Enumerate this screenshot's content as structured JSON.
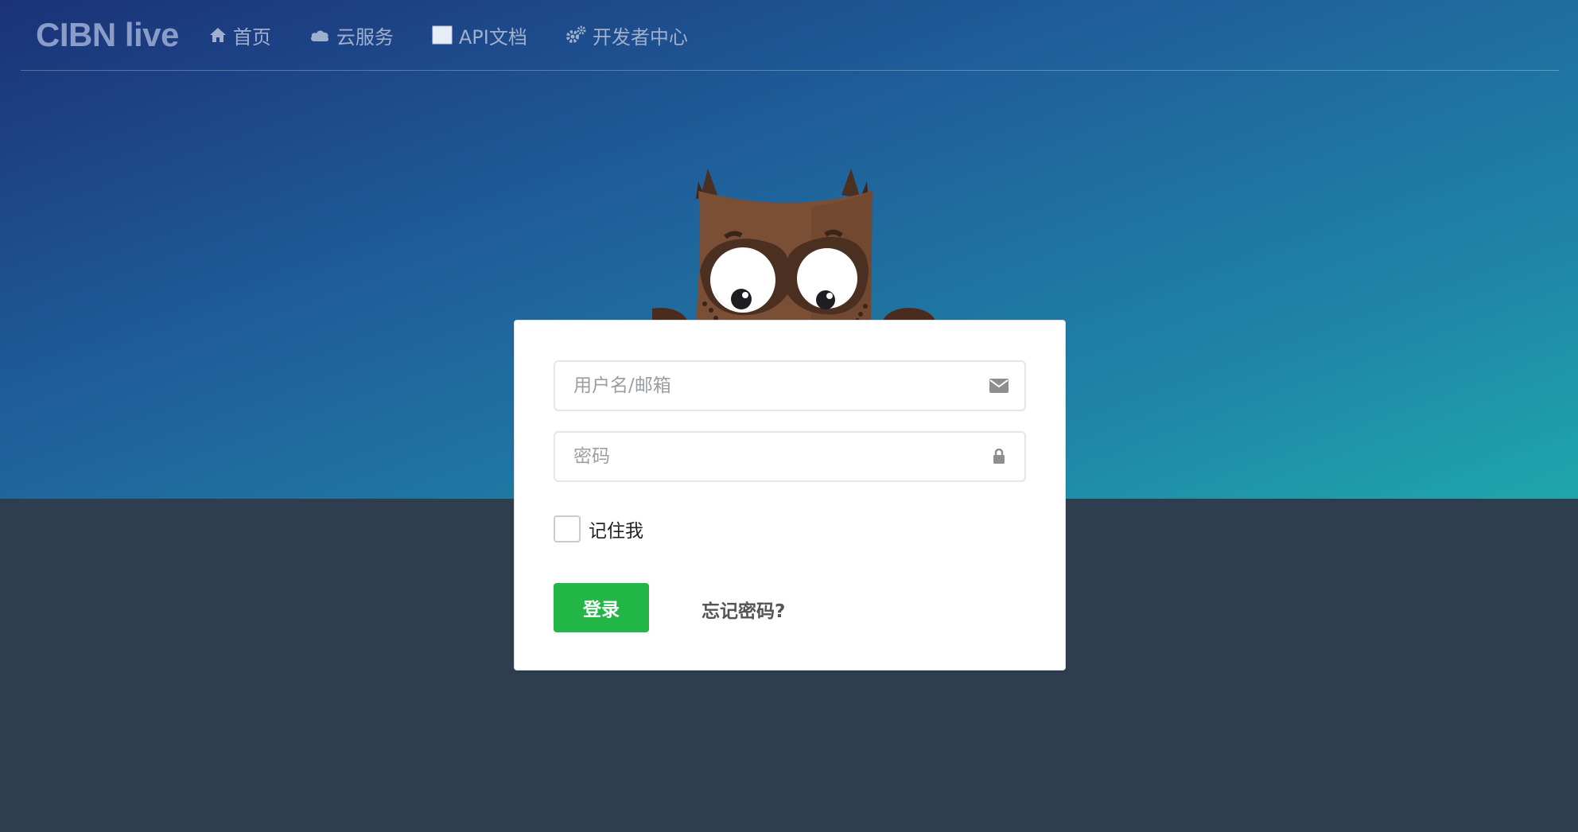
{
  "brand": "CIBN live",
  "nav": [
    {
      "label": "首页",
      "icon": "home-icon"
    },
    {
      "label": "云服务",
      "icon": "cloud-icon"
    },
    {
      "label": "API文档",
      "icon": "document-icon"
    },
    {
      "label": "开发者中心",
      "icon": "gears-icon"
    }
  ],
  "login": {
    "username_placeholder": "用户名/邮箱",
    "username_value": "",
    "password_placeholder": "密码",
    "password_value": "",
    "remember_label": "记住我",
    "remember_checked": false,
    "submit_label": "登录",
    "forgot_label": "忘记密码?"
  },
  "colors": {
    "hero_gradient_start": "#1b3278",
    "hero_gradient_end": "#1fa6ad",
    "footer_bg": "#2f3e4f",
    "login_button": "#22b647",
    "owl_brown": "#7a4f36",
    "owl_beak": "#f6c400"
  }
}
